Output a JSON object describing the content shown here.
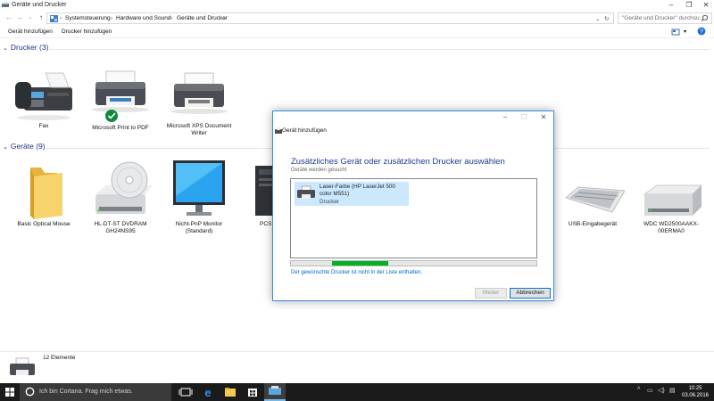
{
  "window": {
    "title": "Geräte und Drucker"
  },
  "address": {
    "breadcrumbs": [
      "Systemsteuerung",
      "Hardware und Sound",
      "Geräte und Drucker"
    ],
    "search_placeholder": "\"Geräte und Drucker\" durchsu..."
  },
  "toolbar": {
    "add_device": "Gerät hinzufügen",
    "add_printer": "Drucker hinzufügen"
  },
  "printers_group": {
    "title": "Drucker (3)",
    "items": [
      {
        "label": "Fax",
        "icon": "fax-icon"
      },
      {
        "label": "Microsoft Print to PDF",
        "icon": "printer-icon",
        "default": true
      },
      {
        "label": "Microsoft XPS Document Writer",
        "icon": "printer-icon"
      }
    ]
  },
  "devices_group": {
    "title": "Geräte (9)",
    "items": [
      {
        "label": "Basic Optical Mouse",
        "icon": "folder-icon"
      },
      {
        "label": "HL-DT-ST DVDRAM GH24NS95",
        "icon": "optical-drive-icon"
      },
      {
        "label": "Nicht-PnP Monitor (Standard)",
        "icon": "monitor-icon"
      },
      {
        "label": "PCSY",
        "icon": "computer-icon"
      },
      {
        "label": "USB-Eingabegerät",
        "icon": "keyboard-icon"
      },
      {
        "label": "WDC WD2500AAKX-00ERMA0",
        "icon": "hard-drive-icon"
      }
    ]
  },
  "status": {
    "count": "12 Elemente"
  },
  "dialog": {
    "title": "Gerät hinzufügen",
    "heading": "Zusätzliches Gerät oder zusätzlichen Drucker auswählen",
    "subtitle": "Geräte werden gesucht",
    "found_device": {
      "name": "Laser-Farbe (HP LaserJet 500 color M551)",
      "type": "Drucker"
    },
    "progress": 0.23,
    "link": "Der gewünschte Drucker ist nicht in der Liste enthalten.",
    "next_button": "Weiter",
    "cancel_button": "Abbrechen"
  },
  "taskbar": {
    "search_placeholder": "Ich bin Cortana. Frag mich etwas.",
    "time": "10:25",
    "date": "03.06.2016"
  },
  "colors": {
    "accent": "#1e3287",
    "selection": "#cce8ff",
    "progress": "#06b025",
    "taskbar": "#1b1b1b"
  }
}
